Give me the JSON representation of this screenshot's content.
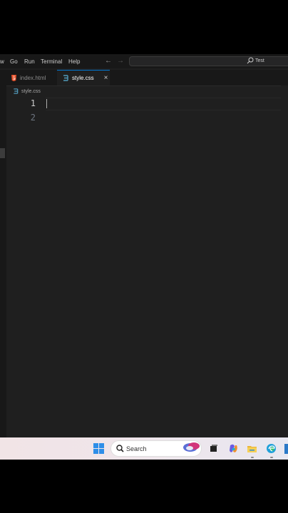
{
  "menubar": {
    "items": [
      {
        "label": "w"
      },
      {
        "label": "Go"
      },
      {
        "label": "Run"
      },
      {
        "label": "Terminal"
      },
      {
        "label": "Help"
      }
    ],
    "back_icon": "arrow-left-icon",
    "forward_icon": "arrow-right-icon",
    "search_label": "Test"
  },
  "tabs": [
    {
      "label": "index.html",
      "icon": "html-file-icon",
      "active": false
    },
    {
      "label": "style.css",
      "icon": "css-file-icon",
      "active": true,
      "close": "×"
    }
  ],
  "breadcrumb": {
    "file": "style.css"
  },
  "editor": {
    "lines": [
      "1",
      "2"
    ]
  },
  "taskbar": {
    "search_placeholder": "Search",
    "icons": [
      "windows-start-icon",
      "search-icon",
      "copilot-swirl-icon",
      "task-view-icon",
      "copilot-icon",
      "file-explorer-icon",
      "edge-icon"
    ]
  },
  "colors": {
    "editor_bg": "#1f1f1f",
    "chrome_bg": "#181818",
    "accent": "#0078d4",
    "css_icon": "#519aba",
    "html_icon": "#e44d26"
  }
}
